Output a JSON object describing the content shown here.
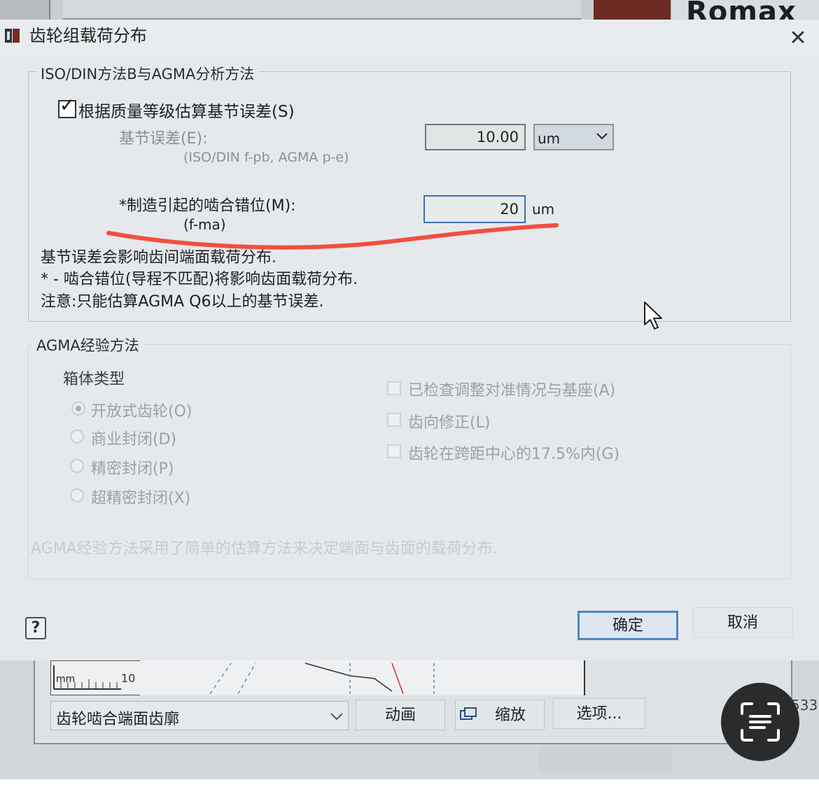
{
  "background_app": {
    "logo_text": "Romax",
    "ruler_unit": "mm",
    "ruler_value": "10",
    "gear_view_select": "齿轮啮合端面齿廓",
    "animate_button": "动画",
    "zoom_button": "缩放",
    "options_button": "选项...",
    "clipped_number": "533"
  },
  "dialog": {
    "title": "齿轮组载荷分布",
    "close_label": "✕",
    "iso_group": {
      "label": "ISO/DIN方法B与AGMA分析方法",
      "estimate_checkbox": {
        "label": "根据质量等级估算基节误差(S)",
        "checked": true
      },
      "pitch_error": {
        "label": "基节误差(E):",
        "sublabel": "(ISO/DIN f-pb, AGMA p-e)",
        "value": "10.00",
        "unit": "um"
      },
      "misalignment": {
        "label": "*制造引起的啮合错位(M):",
        "sublabel": "(f-ma)",
        "value": "20",
        "unit": "um"
      },
      "notes": [
        "基节误差会影响齿间端面载荷分布.",
        "* - 啮合错位(导程不匹配)将影响齿面载荷分布.",
        "注意:只能估算AGMA Q6以上的基节误差."
      ]
    },
    "agma_group": {
      "label": "AGMA经验方法",
      "housing_label": "箱体类型",
      "housing_options": [
        {
          "label": "开放式齿轮(O)",
          "selected": true
        },
        {
          "label": "商业封闭(D)",
          "selected": false
        },
        {
          "label": "精密封闭(P)",
          "selected": false
        },
        {
          "label": "超精密封闭(X)",
          "selected": false
        }
      ],
      "checkboxes": [
        {
          "label": "已检查调整对准情况与基座(A)",
          "checked": false
        },
        {
          "label": "齿向修正(L)",
          "checked": false
        },
        {
          "label": "齿轮在跨距中心的17.5%内(G)",
          "checked": false
        }
      ],
      "note": "AGMA经验方法采用了简单的估算方法来决定端面与齿面的载荷分布."
    },
    "help_button": "?",
    "ok_button": "确定",
    "cancel_button": "取消"
  },
  "colors": {
    "dialog_bg": "#e6e9ec",
    "annotation_red": "#f0503c",
    "focus_blue": "#4d86c4"
  }
}
